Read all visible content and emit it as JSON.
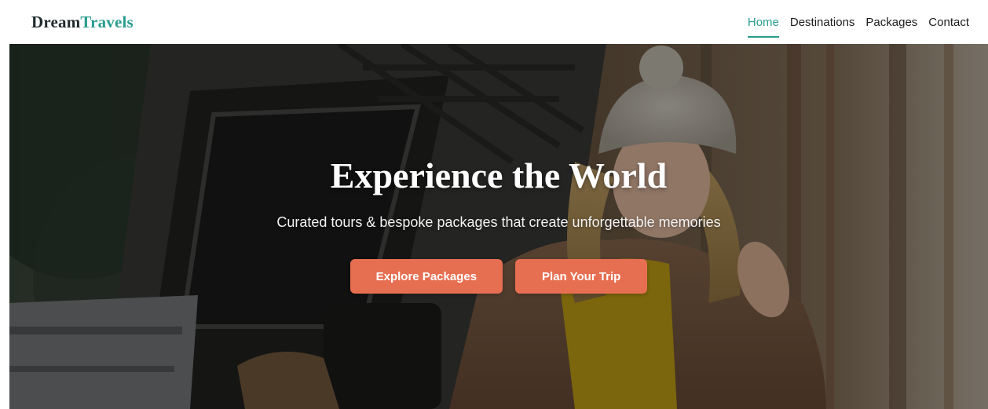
{
  "brand": {
    "name_part1": "Dream",
    "name_part2": "Travels",
    "color_primary": "#1f2a2e",
    "color_accent": "#2a9d8f"
  },
  "nav": {
    "items": [
      {
        "label": "Home",
        "active": true
      },
      {
        "label": "Destinations",
        "active": false
      },
      {
        "label": "Packages",
        "active": false
      },
      {
        "label": "Contact",
        "active": false
      }
    ],
    "active_color": "#2a9d8f"
  },
  "hero": {
    "title": "Experience the World",
    "subtitle": "Curated tours & bespoke packages that create unforgettable memories",
    "buttons": [
      {
        "label": "Explore Packages"
      },
      {
        "label": "Plan Your Trip"
      }
    ],
    "button_color": "#e76f51"
  }
}
